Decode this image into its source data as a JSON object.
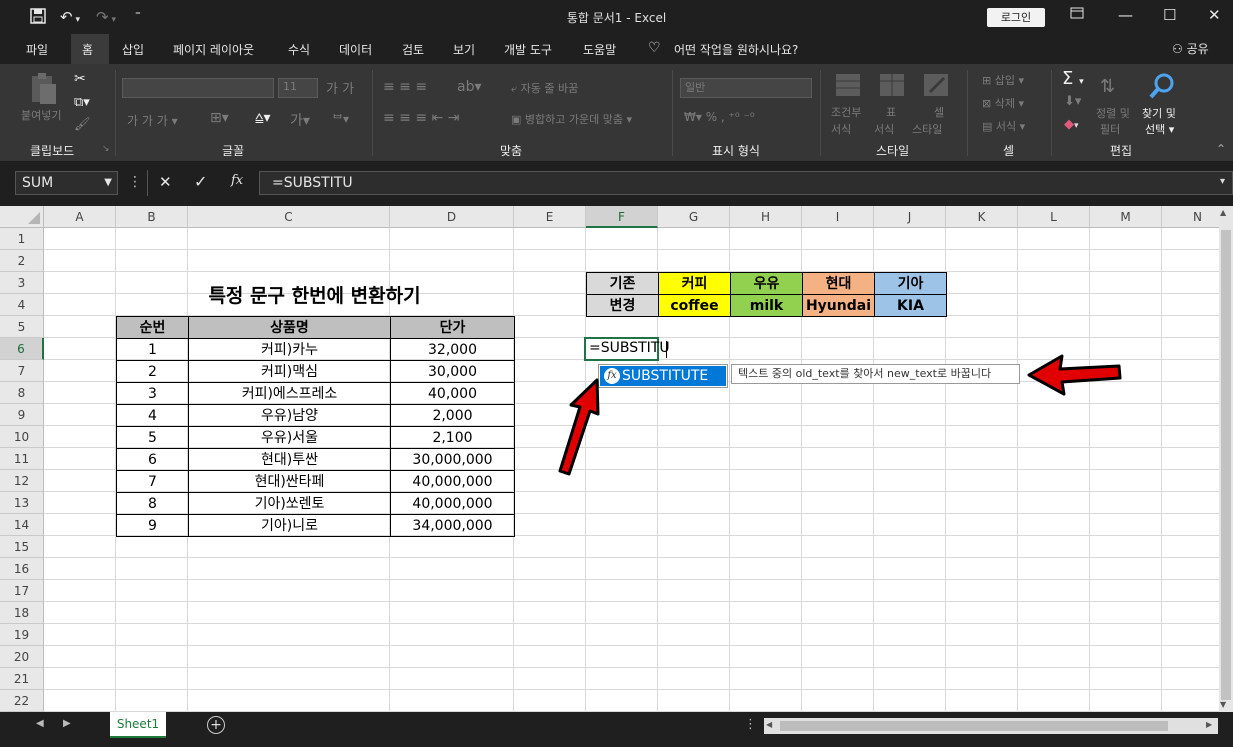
{
  "titlebar": {
    "title": "통합 문서1  -  Excel",
    "login": "로그인"
  },
  "tabs": [
    "파일",
    "홈",
    "삽입",
    "페이지 레이아웃",
    "수식",
    "데이터",
    "검토",
    "보기",
    "개발 도구",
    "도움말"
  ],
  "tellme": "어떤 작업을 원하시나요?",
  "share": "공유",
  "ribbon": {
    "groups": {
      "clipboard": "클립보드",
      "font": "글꼴",
      "align": "맞춤",
      "number": "표시 형식",
      "style": "스타일",
      "cells": "셀",
      "edit": "편집"
    },
    "paste": "붙여넣기",
    "font_size": "11",
    "wrap": "자동 줄 바꿈",
    "merge": "병합하고 가운데 맞춤",
    "number_format": "일반",
    "conditional": "조건부",
    "conditional2": "서식",
    "table": "표",
    "table2": "서식",
    "cellstyle": "셀",
    "cellstyle2": "스타일",
    "insert": "삽입",
    "delete": "삭제",
    "format": "서식",
    "sortfilter": "정렬 및",
    "sortfilter2": "필터",
    "findselect": "찾기 및",
    "findselect2": "선택"
  },
  "namebox": "SUM",
  "formula": "=SUBSTITU",
  "columns": [
    "A",
    "B",
    "C",
    "D",
    "E",
    "F",
    "G",
    "H",
    "I",
    "J",
    "K",
    "L",
    "M",
    "N"
  ],
  "rows": [
    "1",
    "2",
    "3",
    "4",
    "5",
    "6",
    "7",
    "8",
    "9",
    "10",
    "11",
    "12",
    "13",
    "14",
    "15",
    "16",
    "17",
    "18",
    "19",
    "20",
    "21",
    "22"
  ],
  "sheet_title": "특정 문구 한번에 변환하기",
  "table": {
    "headers": [
      "순번",
      "상품명",
      "단가"
    ],
    "rows": [
      [
        "1",
        "커피)카누",
        "32,000"
      ],
      [
        "2",
        "커피)맥심",
        "30,000"
      ],
      [
        "3",
        "커피)에스프레소",
        "40,000"
      ],
      [
        "4",
        "우유)남양",
        "2,000"
      ],
      [
        "5",
        "우유)서울",
        "2,100"
      ],
      [
        "6",
        "현대)투싼",
        "30,000,000"
      ],
      [
        "7",
        "현대)싼타페",
        "40,000,000"
      ],
      [
        "8",
        "기아)쏘렌토",
        "40,000,000"
      ],
      [
        "9",
        "기아)니로",
        "34,000,000"
      ]
    ]
  },
  "mapping": {
    "row1": [
      "기존",
      "커피",
      "우유",
      "현대",
      "기아"
    ],
    "row2": [
      "변경",
      "coffee",
      "milk",
      "Hyundai",
      "KIA"
    ],
    "colors": [
      "#d9d9d9",
      "#ffff00",
      "#92d050",
      "#f4b183",
      "#9dc3e6"
    ]
  },
  "editing_cell": "=SUBSTITU",
  "autocomplete": {
    "item": "SUBSTITUTE",
    "tooltip": "텍스트 중의 old_text를 찾아서 new_text로 바꿉니다"
  },
  "sheet_tab": "Sheet1"
}
